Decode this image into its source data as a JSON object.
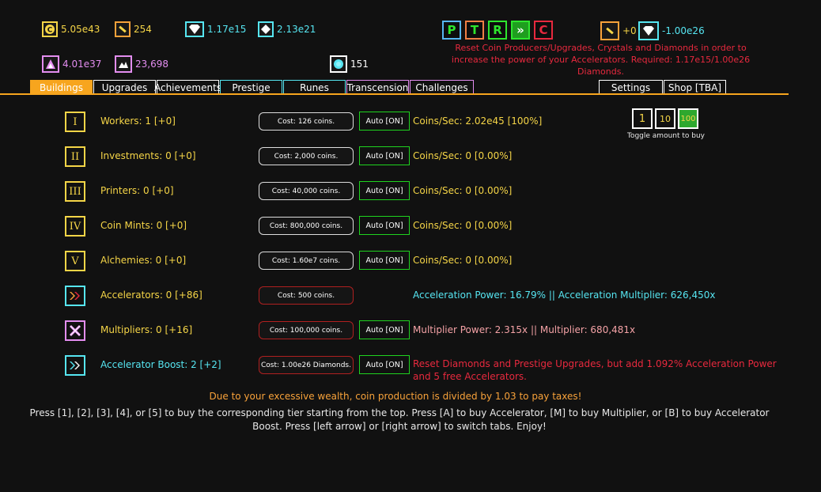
{
  "resources": {
    "coins": "5.05e43",
    "offerings": "254",
    "diamonds": "1.17e15",
    "crystals": "2.13e21",
    "mythos": "4.01e37",
    "particles": "23,698",
    "quarks": "151"
  },
  "reset_buttons": [
    "P",
    "T",
    "R",
    "»",
    "C"
  ],
  "prestige_gain": {
    "offerings_gain": "+0",
    "diamonds_gain": "-1.00e26"
  },
  "reset_info": "Reset Coin Producers/Upgrades, Crystals and Diamonds in order to increase the power of your Accelerators. Required: 1.17e15/1.00e26 Diamonds.",
  "tabs": [
    "Buildings",
    "Upgrades",
    "Achievements",
    "Prestige",
    "Runes",
    "Transcension",
    "Challenges"
  ],
  "right_tabs": [
    "Settings",
    "Shop [TBA]"
  ],
  "buildings": [
    {
      "tier": "I",
      "name": "Workers: 1 [+0]",
      "cost": "Cost: 126 coins.",
      "auto": "Auto [ON]",
      "info": "Coins/Sec: 2.02e45 [100%]"
    },
    {
      "tier": "II",
      "name": "Investments: 0 [+0]",
      "cost": "Cost: 2,000 coins.",
      "auto": "Auto [ON]",
      "info": "Coins/Sec: 0 [0.00%]"
    },
    {
      "tier": "III",
      "name": "Printers: 0 [+0]",
      "cost": "Cost: 40,000 coins.",
      "auto": "Auto [ON]",
      "info": "Coins/Sec: 0 [0.00%]"
    },
    {
      "tier": "IV",
      "name": "Coin Mints: 0 [+0]",
      "cost": "Cost: 800,000 coins.",
      "auto": "Auto [ON]",
      "info": "Coins/Sec: 0 [0.00%]"
    },
    {
      "tier": "V",
      "name": "Alchemies: 0 [+0]",
      "cost": "Cost: 1.60e7 coins.",
      "auto": "Auto [ON]",
      "info": "Coins/Sec: 0 [0.00%]"
    }
  ],
  "accelerators": {
    "name": "Accelerators: 0 [+86]",
    "cost": "Cost: 500 coins.",
    "info": "Acceleration Power: 16.79% || Acceleration Multiplier: 626,450x"
  },
  "multipliers": {
    "name": "Multipliers: 0 [+16]",
    "cost": "Cost: 100,000 coins.",
    "auto": "Auto [ON]",
    "info": "Multiplier Power: 2.315x || Multiplier: 680,481x"
  },
  "accel_boost": {
    "name": "Accelerator Boost: 2 [+2]",
    "cost": "Cost: 1.00e26 Diamonds.",
    "auto": "Auto [ON]",
    "info": "Reset Diamonds and Prestige Upgrades, but add 1.092% Acceleration Power and 5 free Accelerators."
  },
  "buy_amounts": [
    "1",
    "10",
    "100"
  ],
  "buy_amount_label": "Toggle amount to buy",
  "tax_message": "Due to your excessive wealth, coin production is divided by 1.03 to pay taxes!",
  "help_text": "Press [1], [2], [3], [4], or [5] to buy the corresponding tier starting from the top. Press [A] to buy Accelerator, [M] to buy Multiplier, or [B] to buy Accelerator Boost. Press [left arrow] or [right arrow] to switch tabs. Enjoy!",
  "colors": {
    "accent": "#f7a51e",
    "gold": "#f5d547",
    "cyan": "#56e6f2",
    "purple": "#e38df0",
    "red": "#e8293e",
    "green": "#2ee62e"
  }
}
